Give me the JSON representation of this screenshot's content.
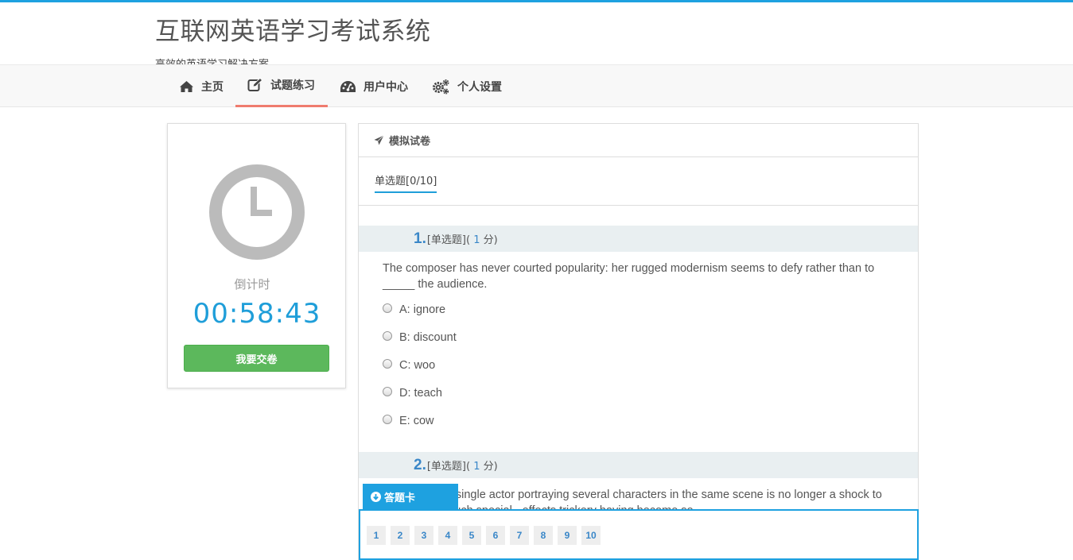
{
  "brand": {
    "title": "互联网英语学习考试系统",
    "subtitle": "高效的英语学习解决方案"
  },
  "nav": {
    "items": [
      {
        "label": "主页",
        "icon": "home-icon"
      },
      {
        "label": "试题练习",
        "icon": "edit-icon",
        "active": true
      },
      {
        "label": "用户中心",
        "icon": "dashboard-icon"
      },
      {
        "label": "个人设置",
        "icon": "gears-icon"
      }
    ]
  },
  "timer": {
    "label": "倒计时",
    "value": "00:58:43",
    "submit_label": "我要交卷"
  },
  "paper": {
    "title": "模拟试卷",
    "tab_label": "单选题[0/10]",
    "questions": [
      {
        "number": "1.",
        "type": "[单选题]",
        "score_open": "(",
        "points": "1",
        "score_close": "分)",
        "text": "The composer has never courted popularity: her rugged modernism seems to defy rather than to _____ the audience.",
        "options": [
          "A: ignore",
          "B: discount",
          "C: woo",
          "D: teach",
          "E: cow"
        ]
      },
      {
        "number": "2.",
        "type": "[单选题]",
        "score_open": "(",
        "points": "1",
        "score_close": "分)",
        "text": "The sight of a single actor portraying several characters in the same scene is no longer a shock to moviegoers, such special - effects trickery having become so"
      }
    ]
  },
  "answer_card": {
    "label": "答题卡",
    "numbers": [
      "1",
      "2",
      "3",
      "4",
      "5",
      "6",
      "7",
      "8",
      "9",
      "10"
    ]
  },
  "colors": {
    "accent": "#1ea1e0",
    "nav_active_underline": "#ef7b6e",
    "submit_green": "#5cb85c",
    "question_number_blue": "#3a87c8"
  }
}
